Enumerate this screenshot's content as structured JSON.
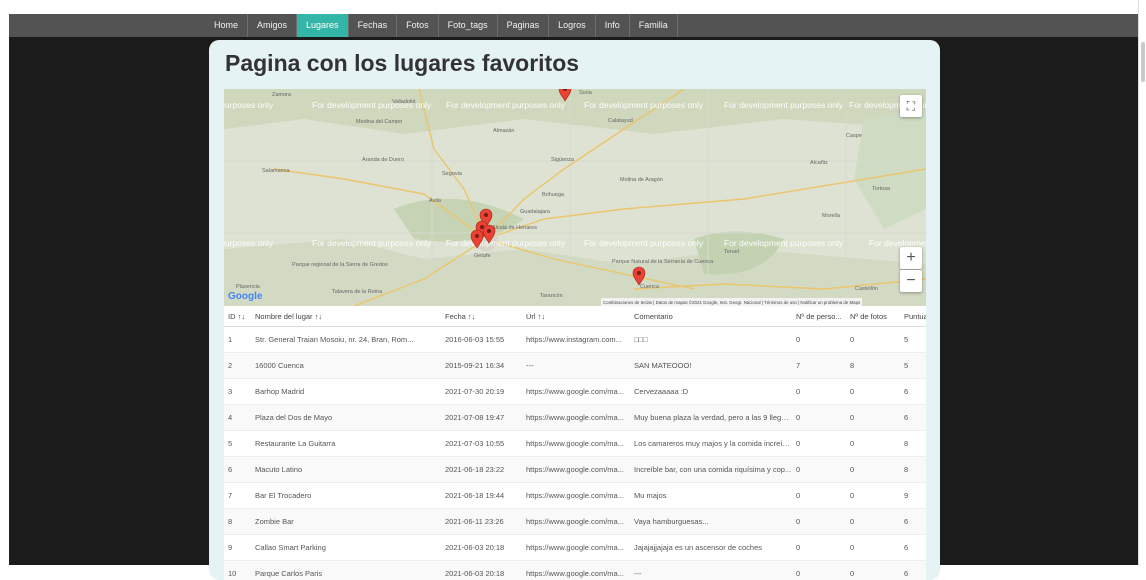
{
  "nav": {
    "items": [
      {
        "label": "Home",
        "active": false
      },
      {
        "label": "Amigos",
        "active": false
      },
      {
        "label": "Lugares",
        "active": true
      },
      {
        "label": "Fechas",
        "active": false
      },
      {
        "label": "Fotos",
        "active": false
      },
      {
        "label": "Foto_tags",
        "active": false
      },
      {
        "label": "Paginas",
        "active": false
      },
      {
        "label": "Logros",
        "active": false
      },
      {
        "label": "Info",
        "active": false
      },
      {
        "label": "Familia",
        "active": false
      }
    ]
  },
  "page": {
    "title": "Pagina con los lugares favoritos"
  },
  "map": {
    "watermark": "For development purposes only",
    "places": [
      "Salamanca",
      "Segovia",
      "Ávila",
      "Guadalajara",
      "Getafe",
      "Alcalá de Henares",
      "Medina del Campo",
      "Aranda de Duero",
      "Cuenca",
      "Teruel",
      "Molina de Aragón",
      "Parque Natural de la Serranía de Cuenca",
      "Talavera de la Reina",
      "Plasencia",
      "Tarancón",
      "Castellón",
      "Parque regional de la Sierra de Gredos",
      "Sigüenza",
      "Calatayud",
      "Alcañiz",
      "Tortosa",
      "Morella",
      "Brihuega",
      "Almazán",
      "Zamora",
      "Valladolid",
      "Soria",
      "Caspe"
    ],
    "logo": "Google",
    "attribution": "Combinaciones de teclas | Datos de mapas ©2021 Google, Inst. Geogr. Nacional | Términos de uso | Notificar un problema de Maps",
    "fullscreen_icon": "⛶",
    "zoom_in_label": "+",
    "zoom_out_label": "−"
  },
  "table": {
    "headers": [
      "ID ↑↓",
      "Nombre del lugar ↑↓",
      "Fecha ↑↓",
      "Url ↑↓",
      "Comentario",
      "Nº de perso...",
      "Nº de fotos",
      "Puntuacion"
    ],
    "rows": [
      [
        "1",
        "Str. General Traian Mosoiu, nr. 24, Bran, Rom...",
        "2016-06-03 15:55",
        "https://www.instagram.com...",
        "□□□",
        "0",
        "0",
        "5"
      ],
      [
        "2",
        "16000 Cuenca",
        "2015-09-21 16:34",
        "---",
        "SAN MATEOOO!",
        "7",
        "8",
        "5"
      ],
      [
        "3",
        "Barhop Madrid",
        "2021-07-30 20:19",
        "https://www.google.com/ma...",
        "Cervezaaaaa :D",
        "0",
        "0",
        "6"
      ],
      [
        "4",
        "Plaza del Dos de Mayo",
        "2021-07-08 19:47",
        "https://www.google.com/ma...",
        "Muy buena plaza la verdad, pero a las 9 llega l...",
        "0",
        "0",
        "6"
      ],
      [
        "5",
        "Restaurante La Guitarra",
        "2021-07-03 10:55",
        "https://www.google.com/ma...",
        "Los camareros muy majos y la comida increíb...",
        "0",
        "0",
        "8"
      ],
      [
        "6",
        "Macuto Latino",
        "2021-06-18 23:22",
        "https://www.google.com/ma...",
        "Increíble bar, con una comida riquísima y cop...",
        "0",
        "0",
        "8"
      ],
      [
        "7",
        "Bar El Trocadero",
        "2021-06-18 19:44",
        "https://www.google.com/ma...",
        "Mu majos",
        "0",
        "0",
        "9"
      ],
      [
        "8",
        "Zombie Bar",
        "2021-06-11 23:26",
        "https://www.google.com/ma...",
        "Vaya hamburguesas...",
        "0",
        "0",
        "6"
      ],
      [
        "9",
        "Callao Smart Parking",
        "2021-06-03 20:18",
        "https://www.google.com/ma...",
        "Jajajajjajaja es un ascensor de coches",
        "0",
        "0",
        "6"
      ],
      [
        "10",
        "Parque Carlos Paris",
        "2021-06-03 20:18",
        "https://www.google.com/ma...",
        "---",
        "0",
        "0",
        "6"
      ]
    ]
  }
}
